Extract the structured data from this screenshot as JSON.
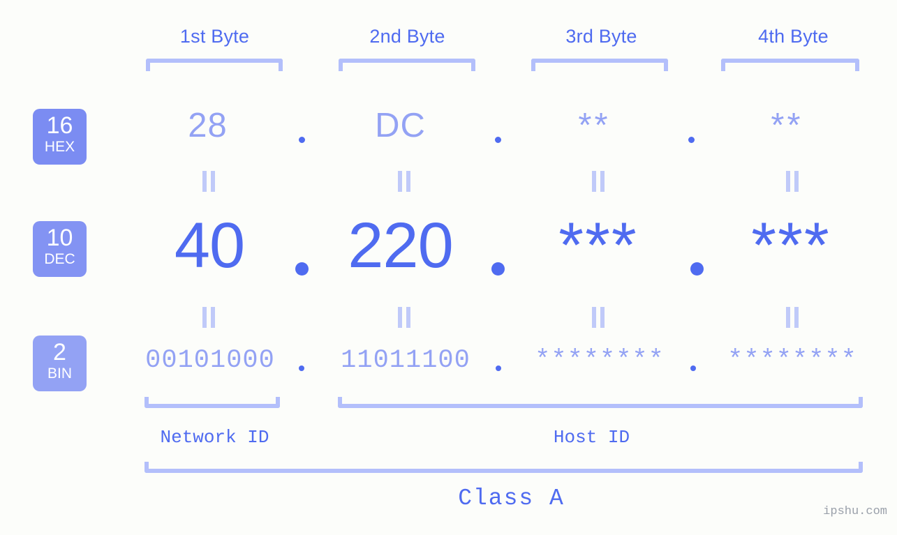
{
  "meta": {
    "background_color": "#fcfdfa",
    "accent_color": "#4f6bf0",
    "light_accent_color": "#93a2f4",
    "bracket_color": "#b3bffb",
    "equals_color": "#c0caf9",
    "watermark": "ipshu.com"
  },
  "byte_headers": [
    {
      "label": "1st Byte"
    },
    {
      "label": "2nd Byte"
    },
    {
      "label": "3rd Byte"
    },
    {
      "label": "4th Byte"
    }
  ],
  "bases": [
    {
      "number": "16",
      "name": "HEX",
      "color": "#7b8cf2"
    },
    {
      "number": "10",
      "name": "DEC",
      "color": "#8393f3"
    },
    {
      "number": "2",
      "name": "BIN",
      "color": "#93a2f4"
    }
  ],
  "rows": {
    "hex": {
      "base_number": "16",
      "base_name": "HEX",
      "values": [
        "28",
        "DC",
        "**",
        "**"
      ],
      "separator": "."
    },
    "dec": {
      "base_number": "10",
      "base_name": "DEC",
      "values": [
        "40",
        "220",
        "***",
        "***"
      ],
      "separator": "."
    },
    "bin": {
      "base_number": "2",
      "base_name": "BIN",
      "values": [
        "00101000",
        "11011100",
        "********",
        "********"
      ],
      "separator": "."
    }
  },
  "equals_marks": {
    "symbol": "||",
    "count_per_row": 4
  },
  "segments": {
    "network_id": {
      "label": "Network ID"
    },
    "host_id": {
      "label": "Host ID"
    },
    "class": {
      "label": "Class A"
    }
  }
}
